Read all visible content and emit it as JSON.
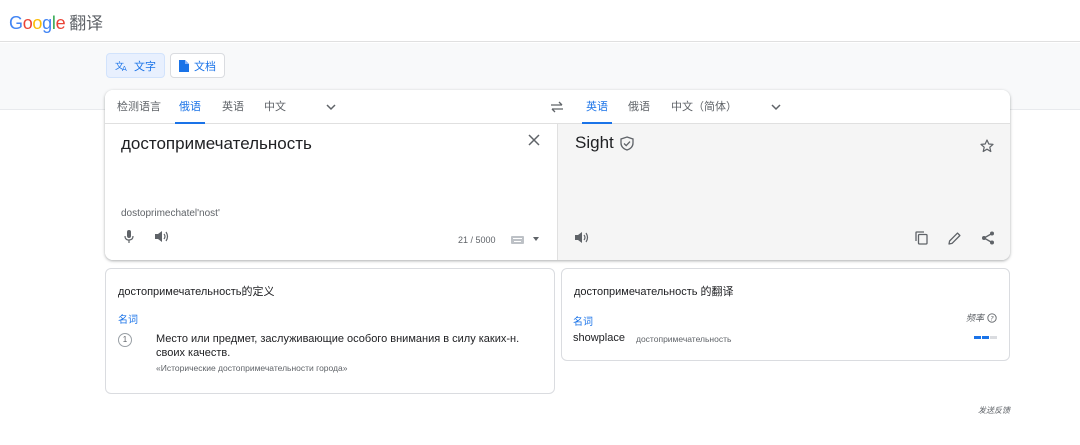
{
  "header": {
    "brand": "Google",
    "product": "翻译"
  },
  "modes": {
    "text_label": "文字",
    "docs_label": "文档"
  },
  "source_langs": [
    {
      "label": "检测语言",
      "selected": false
    },
    {
      "label": "俄语",
      "selected": true
    },
    {
      "label": "英语",
      "selected": false
    },
    {
      "label": "中文",
      "selected": false
    }
  ],
  "target_langs": [
    {
      "label": "英语",
      "selected": true
    },
    {
      "label": "俄语",
      "selected": false
    },
    {
      "label": "中文（简体）",
      "selected": false
    }
  ],
  "source": {
    "text": "достопримечательность",
    "transliteration": "dostoprimechatel'nost'",
    "char_count": "21 / 5000"
  },
  "target": {
    "text": "Sight"
  },
  "definitions": {
    "title": "достопримечательность的定义",
    "pos": "名词",
    "items": [
      {
        "num": "1",
        "line1": "Место или предмет, заслуживающие особого внимания в силу каких-н.",
        "line2": "своих качеств.",
        "example": "«Исторические достопримечательности города»"
      }
    ]
  },
  "translations": {
    "title": "достопримечательность 的翻译",
    "pos": "名词",
    "frequency_label": "频率",
    "items": [
      {
        "word": "showplace",
        "back": "достопримечательность",
        "frequency": 2
      }
    ]
  },
  "footer": {
    "feedback": "发送反馈"
  },
  "colors": {
    "accent": "#1a73e8",
    "target_bg": "#f5f5f5"
  }
}
